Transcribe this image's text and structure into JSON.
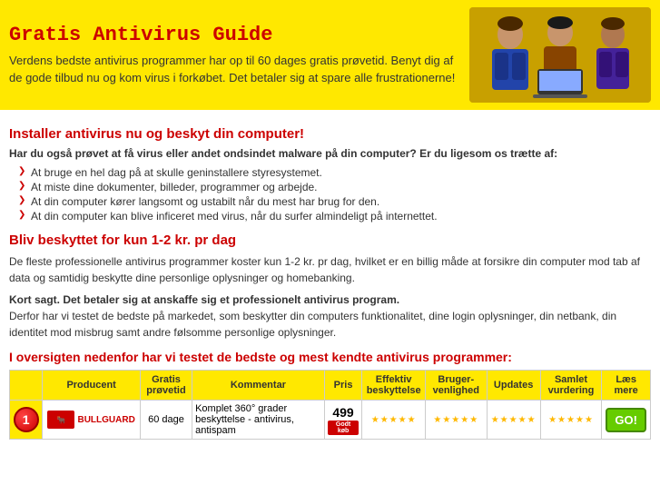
{
  "header": {
    "title": "Gratis Antivirus Guide",
    "description": "Verdens bedste antivirus programmer har op til 60 dages gratis prøvetid. Benyt dig af de gode tilbud nu og kom virus i forkøbet. Det betaler sig at spare alle frustrationerne!"
  },
  "section1": {
    "title": "Installer antivirus nu og beskyt din computer!",
    "intro": "Har du også prøvet at få virus eller andet ondsindet malware på din computer? Er du ligesom os trætte af:",
    "bullets": [
      "At bruge en hel dag på at skulle geninstallere styresystemet.",
      "At miste dine dokumenter, billeder, programmer og arbejde.",
      "At din computer kører langsomt og ustabilt når du mest har brug for den.",
      "At din computer kan blive inficeret med virus, når du surfer almindeligt på internettet."
    ]
  },
  "section2": {
    "title": "Bliv beskyttet for kun 1-2 kr. pr dag",
    "para1": "De fleste professionelle antivirus programmer koster kun 1-2 kr. pr dag, hvilket er en billig måde at forsikre din computer mod tab af data og samtidig beskytte dine personlige oplysninger og homebanking.",
    "para2bold": "Kort sagt. Det betaler sig at anskaffe sig et professionelt antivirus program.",
    "para2": "Derfor har vi testet de bedste på markedet, som beskytter din computers funktionalitet, dine login oplysninger, din netbank, din identitet mod misbrug samt andre følsomme personlige oplysninger."
  },
  "section3": {
    "title": "I oversigten nedenfor har vi testet de bedste og mest kendte antivirus programmer:"
  },
  "table": {
    "headers": [
      "Producent",
      "Gratis prøvetid",
      "Kommentar",
      "Pris",
      "Effektiv beskyttelse",
      "Bruger-venlighed",
      "Updates",
      "Samlet vurdering",
      "Læs mere"
    ],
    "rows": [
      {
        "rank": "1",
        "producer": "BULLGUARD",
        "gratis": "60 dage",
        "comment": "Komplet 360° grader beskyttelse - antivirus, antispam",
        "price": "499",
        "price_badge": "Godt køb",
        "effektiv": "★★★★★",
        "bruger": "★★★★★",
        "updates": "★★★★★",
        "samlet": "★★★★★",
        "laes": "GO!"
      }
    ]
  }
}
